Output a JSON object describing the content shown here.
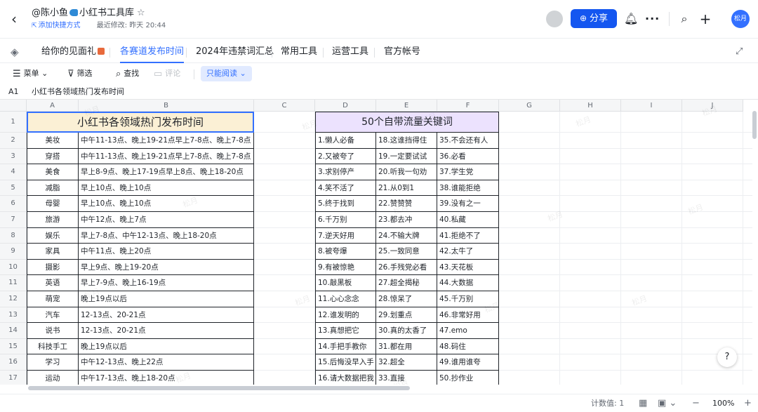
{
  "header": {
    "back_icon": "chevron-left-icon",
    "title_prefix": "@陈小鱼",
    "title_name": "小红书工具库",
    "star_icon": "☆",
    "shortcut_label": "添加快捷方式",
    "last_modified": "最近修改: 昨天 20:44",
    "share_label": "分享",
    "user_avatar_text": "松月"
  },
  "tabs": [
    {
      "label": "给你的见面礼"
    },
    {
      "label": "各赛道发布时间"
    },
    {
      "label": "2024年违禁词汇总"
    },
    {
      "label": "常用工具"
    },
    {
      "label": "运营工具"
    },
    {
      "label": "官方帐号"
    }
  ],
  "toolbar": {
    "menu_label": "菜单",
    "filter_label": "筛选",
    "find_label": "查找",
    "comment_label": "评论",
    "readonly_label": "只能阅读"
  },
  "formula_bar": {
    "cell_ref": "A1",
    "value": "小红书各领域热门发布时间"
  },
  "columns": [
    "A",
    "B",
    "C",
    "D",
    "E",
    "F",
    "G",
    "H",
    "I",
    "J"
  ],
  "rows": [
    "1",
    "2",
    "3",
    "4",
    "5",
    "6",
    "7",
    "8",
    "9",
    "10",
    "11",
    "12",
    "13",
    "14",
    "15",
    "16",
    "17"
  ],
  "sheet": {
    "title_left": "小红书各领域热门发布时间",
    "title_right": "50个自带流量关键词",
    "categories": [
      {
        "domain": "美妆",
        "time": "中午11-13点、晚上19-21点早上7-8点、晚上7-8点"
      },
      {
        "domain": "穿搭",
        "time": "中午11-13点、晚上19-21点早上7-8点、晚上7-8点"
      },
      {
        "domain": "美食",
        "time": "早上8-9点、晚上17-19点早上8点、晚上18-20点"
      },
      {
        "domain": "减脂",
        "time": "早上10点、晚上10点"
      },
      {
        "domain": "母婴",
        "time": "早上10点、晚上10点"
      },
      {
        "domain": "旅游",
        "time": "中午12点、晚上7点"
      },
      {
        "domain": "娱乐",
        "time": "早上7-8点、中午12-13点、晚上18-20点"
      },
      {
        "domain": "家具",
        "time": "中午11点、晚上20点"
      },
      {
        "domain": "摄影",
        "time": "早上9点、晚上19-20点"
      },
      {
        "domain": "英语",
        "time": "早上7-9点、晚上16-19点"
      },
      {
        "domain": "萌宠",
        "time": "晚上19点以后"
      },
      {
        "domain": "汽车",
        "time": "12-13点、20-21点"
      },
      {
        "domain": "说书",
        "time": "12-13点、20-21点"
      },
      {
        "domain": "科技手工",
        "time": "晚上19点以后"
      },
      {
        "domain": "学习",
        "time": "中午12-13点、晚上22点"
      },
      {
        "domain": "运动",
        "time": "中午17-13点、晚上18-20点"
      }
    ],
    "keywords": [
      [
        "1.懒人必备",
        "18.这谁挡得住",
        "35.不会还有人"
      ],
      [
        "2.又被夸了",
        "19.一定要试试",
        "36.必看"
      ],
      [
        "3.求别停产",
        "20.听我一句劝",
        "37.学生党"
      ],
      [
        "4.笑不活了",
        "21.从0到1",
        "38.谁能拒绝"
      ],
      [
        "5.终于找到",
        "22.赞赞赞",
        "39.没有之一"
      ],
      [
        "6.千万别",
        "23.都去冲",
        "40.私藏"
      ],
      [
        "7.逆天好用",
        "24.不输大牌",
        "41.拒绝不了"
      ],
      [
        "8.被夸爆",
        "25.一致同意",
        "42.太牛了"
      ],
      [
        "9.有被惊艳",
        "26.手残党必看",
        "43.天花板"
      ],
      [
        "10.敲黑板",
        "27.超全揭秘",
        "44.大数据"
      ],
      [
        "11.心心念念",
        "28.惊呆了",
        "45.千万别"
      ],
      [
        "12.谁发明的",
        "29.划重点",
        "46.非常好用"
      ],
      [
        "13.真想把它",
        "30.真的太香了",
        "47.emo"
      ],
      [
        "14.手把手教你",
        "31.都在用",
        "48.码住"
      ],
      [
        "15.后悔没早入手",
        "32.超全",
        "49.谁用谁夸"
      ],
      [
        "16.请大数据把我",
        "33.直接",
        "50.抄作业"
      ]
    ]
  },
  "status": {
    "count_label": "计数值: 1",
    "zoom": "100%"
  },
  "watermark_text": "松月",
  "colors": {
    "accent": "#3370ff",
    "share_bg": "#1456f0",
    "title_left_bg": "#fbf0d5",
    "title_right_bg": "#ece2fe"
  }
}
